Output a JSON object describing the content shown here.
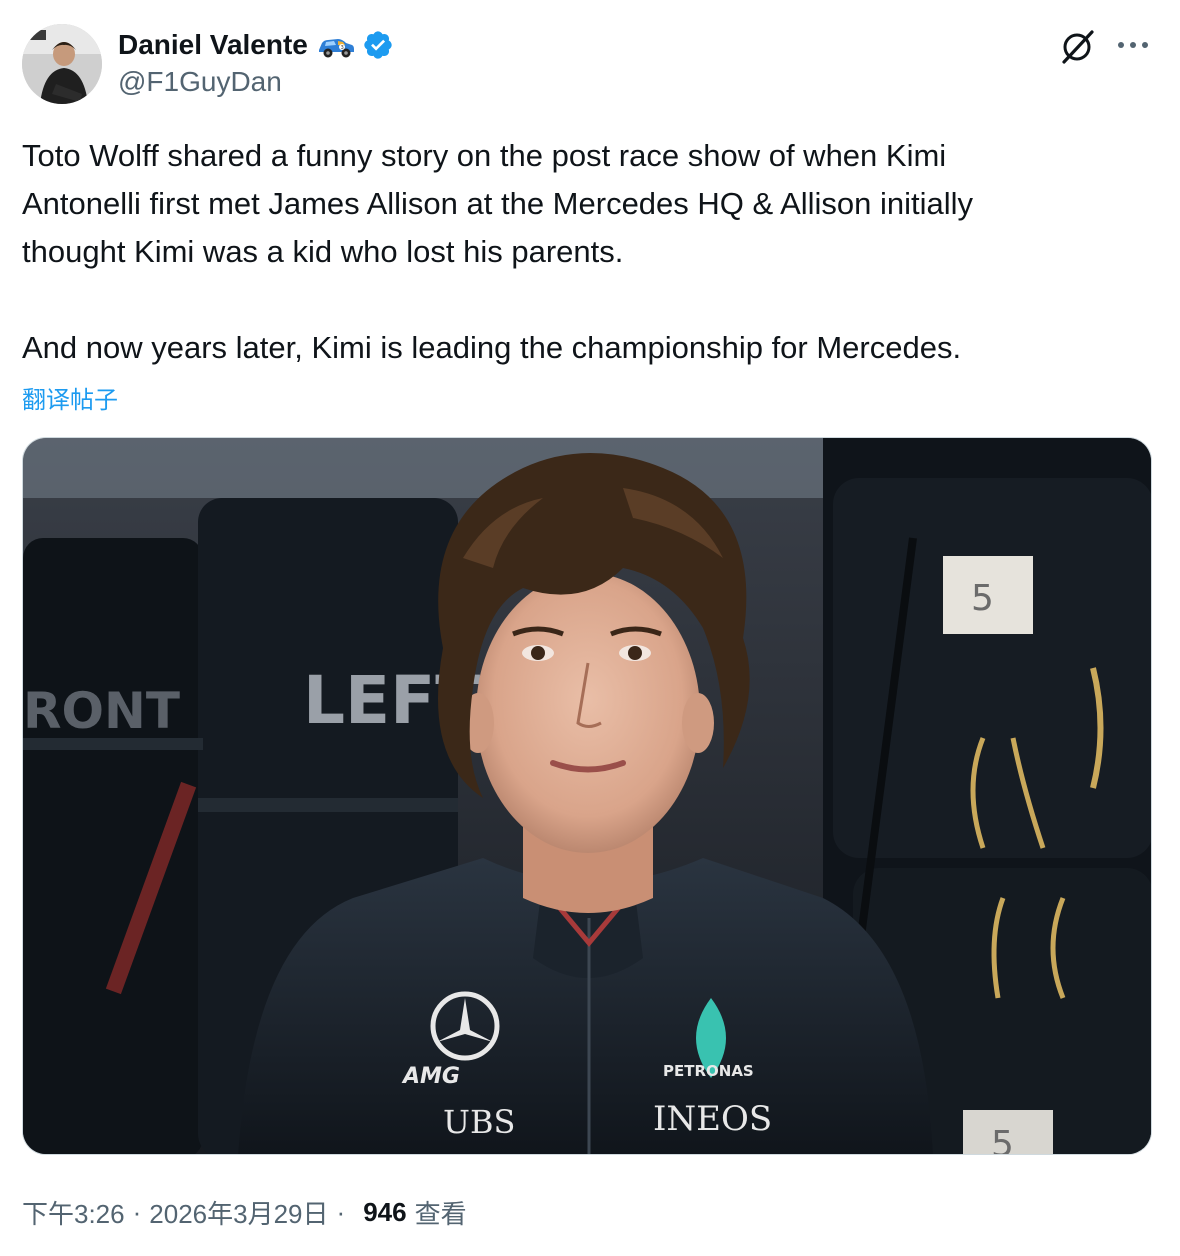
{
  "author": {
    "display_name": "Daniel Valente",
    "handle": "@F1GuyDan",
    "avatar_icon": "avatar-photo",
    "name_emoji_icon": "race-car-emoji-icon",
    "verified_icon": "verified-badge-icon",
    "verified_color": "#1d9bf0"
  },
  "header_actions": {
    "grok_icon": "grok-icon",
    "more_icon": "more-options-icon"
  },
  "tweet": {
    "text": "Toto Wolff shared a funny story on the post race show of when Kimi\nAntonelli first met James Allison at the Mercedes HQ & Allison initially\nthought Kimi was a kid who lost his parents.\n\nAnd now years later, Kimi is leading the championship for Mercedes.",
    "translate_label": "翻译帖子"
  },
  "media": {
    "image_icon": "photo-young-driver-mercedes-jacket",
    "visible_text": {
      "tyre_left": "LEFT",
      "tyre_front": "RONT",
      "tag_number": "5",
      "tag_number_bottom": "5",
      "sponsor_amg": "AMG",
      "sponsor_petronas": "PETRONAS",
      "sponsor_ubs": "UBS",
      "sponsor_ineos": "INEOS"
    }
  },
  "meta": {
    "time": "下午3:26",
    "date": "2026年3月29日",
    "separator": "·",
    "views_count": "946",
    "views_label": "查看"
  },
  "colors": {
    "text_primary": "#0f1419",
    "text_secondary": "#536471",
    "link": "#1d9bf0"
  }
}
